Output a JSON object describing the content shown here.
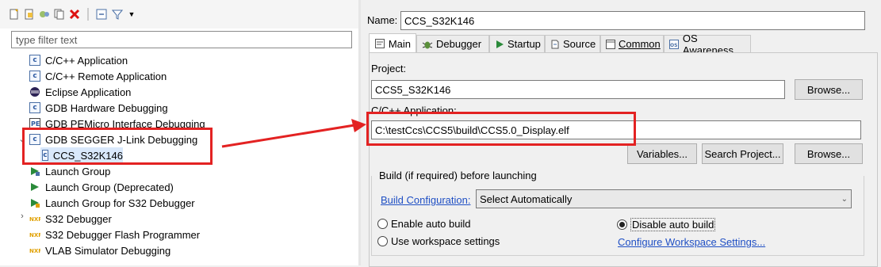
{
  "left": {
    "filter_placeholder": "type filter text",
    "tree": [
      {
        "label": "C/C++ Application",
        "icon": "c-app-icon"
      },
      {
        "label": "C/C++ Remote Application",
        "icon": "c-app-icon"
      },
      {
        "label": "Eclipse Application",
        "icon": "eclipse-icon"
      },
      {
        "label": "GDB Hardware Debugging",
        "icon": "c-app-icon"
      },
      {
        "label": "GDB PEMicro Interface Debugging",
        "icon": "pemicro-icon"
      },
      {
        "label": "GDB SEGGER J-Link Debugging",
        "icon": "c-app-icon"
      },
      {
        "label": "CCS_S32K146",
        "icon": "c-app-icon"
      },
      {
        "label": "Launch Group",
        "icon": "launch-group-icon"
      },
      {
        "label": "Launch Group (Deprecated)",
        "icon": "launch-group-icon"
      },
      {
        "label": "Launch Group for S32 Debugger",
        "icon": "launch-group-icon"
      },
      {
        "label": "S32 Debugger",
        "icon": "nxp-icon"
      },
      {
        "label": "S32 Debugger Flash Programmer",
        "icon": "nxp-icon"
      },
      {
        "label": "VLAB Simulator Debugging",
        "icon": "nxp-icon"
      }
    ]
  },
  "right": {
    "name_label": "Name:",
    "name_value": "CCS_S32K146",
    "tabs": [
      {
        "label": "Main",
        "icon": "main-tab-icon"
      },
      {
        "label": "Debugger",
        "icon": "bug-icon"
      },
      {
        "label": "Startup",
        "icon": "play-icon"
      },
      {
        "label": "Source",
        "icon": "source-icon"
      },
      {
        "label": "Common",
        "icon": "common-icon"
      },
      {
        "label": "OS Awareness",
        "icon": "os-icon"
      }
    ],
    "project_label": "Project:",
    "project_value": "CCS5_S32K146",
    "browse1": "Browse...",
    "app_label": "C/C++ Application:",
    "app_value": "C:\\testCcs\\CCS5\\build\\CCS5.0_Display.elf",
    "variables": "Variables...",
    "search_project": "Search Project...",
    "browse2": "Browse...",
    "build_group": "Build (if required) before launching",
    "build_config_link": "Build Configuration:",
    "build_config_value": "Select Automatically",
    "radio_enable": "Enable auto build",
    "radio_disable": "Disable auto build",
    "radio_workspace": "Use workspace settings",
    "configure_link": "Configure Workspace Settings..."
  },
  "colors": {
    "accent_red": "#e32222",
    "link": "#1f4fc4"
  }
}
